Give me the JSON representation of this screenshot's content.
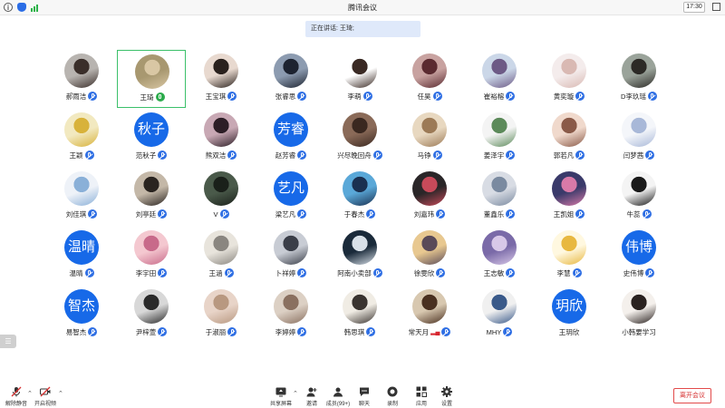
{
  "window": {
    "title": "腾讯会议",
    "clock": "17:30"
  },
  "speaker_bar": {
    "text": "正在讲话: 王琦;"
  },
  "colors": {
    "accent": "#1769e8",
    "active_border": "#3bc06a",
    "mic_icon": "#2f6fe4",
    "leave": "#d63030"
  },
  "participants": [
    {
      "name": "郝雨洁",
      "mic": "muted",
      "avatar": {
        "kind": "photo",
        "colors": [
          "#b8b4b0",
          "#3a2e2a"
        ]
      }
    },
    {
      "name": "王琦",
      "mic": "speaking",
      "active": true,
      "avatar": {
        "kind": "photo",
        "colors": [
          "#a89870",
          "#d9c7a4"
        ]
      }
    },
    {
      "name": "王宝琪",
      "mic": "muted",
      "avatar": {
        "kind": "photo",
        "colors": [
          "#e8d9cf",
          "#2a211d"
        ]
      }
    },
    {
      "name": "张睿思",
      "mic": "muted",
      "avatar": {
        "kind": "photo",
        "colors": [
          "#8c9bb0",
          "#1d2330"
        ]
      }
    },
    {
      "name": "李萌",
      "mic": "muted",
      "avatar": {
        "kind": "photo",
        "colors": [
          "#ffffff",
          "#3a2a24"
        ]
      }
    },
    {
      "name": "任昊",
      "mic": "muted",
      "avatar": {
        "kind": "photo",
        "colors": [
          "#c8a2a0",
          "#5a2a30"
        ]
      }
    },
    {
      "name": "崔裕榕",
      "mic": "muted",
      "avatar": {
        "kind": "photo",
        "colors": [
          "#cbd7e8",
          "#6d5a86"
        ]
      }
    },
    {
      "name": "黄奕璇",
      "mic": "muted",
      "avatar": {
        "kind": "photo",
        "colors": [
          "#f4ecec",
          "#d9b9b3"
        ]
      }
    },
    {
      "name": "D李玖瑶",
      "mic": "muted",
      "avatar": {
        "kind": "photo",
        "colors": [
          "#9aa39a",
          "#2c2a26"
        ]
      }
    },
    {
      "name": "王颖",
      "mic": "muted",
      "avatar": {
        "kind": "photo",
        "colors": [
          "#f2e9c0",
          "#d8b23a"
        ]
      }
    },
    {
      "name": "范秋子",
      "mic": "muted",
      "avatar": {
        "kind": "text",
        "text": "秋子"
      }
    },
    {
      "name": "熊双洁",
      "mic": "muted",
      "avatar": {
        "kind": "photo",
        "colors": [
          "#c8a8b4",
          "#2c1e26"
        ]
      }
    },
    {
      "name": "赵芳睿",
      "mic": "muted",
      "avatar": {
        "kind": "text",
        "text": "芳睿"
      }
    },
    {
      "name": "兴尽晚回舟",
      "mic": "muted",
      "avatar": {
        "kind": "photo",
        "colors": [
          "#8a6a58",
          "#3a2820"
        ]
      }
    },
    {
      "name": "马铮",
      "mic": "muted",
      "avatar": {
        "kind": "photo",
        "colors": [
          "#e8d8c0",
          "#9c7a56"
        ]
      }
    },
    {
      "name": "姜泽宇",
      "mic": "muted",
      "avatar": {
        "kind": "photo",
        "colors": [
          "#f4f4f4",
          "#5c8a5a"
        ]
      }
    },
    {
      "name": "郭若凡",
      "mic": "muted",
      "avatar": {
        "kind": "photo",
        "colors": [
          "#f0d9cc",
          "#8a5a48"
        ]
      }
    },
    {
      "name": "闫梦茜",
      "mic": "muted",
      "avatar": {
        "kind": "photo",
        "colors": [
          "#f4f6fa",
          "#a8b8d8"
        ]
      }
    },
    {
      "name": "刘佳琪",
      "mic": "muted",
      "avatar": {
        "kind": "photo",
        "colors": [
          "#eef2f8",
          "#8ab0d8"
        ]
      }
    },
    {
      "name": "刘亭廷",
      "mic": "muted",
      "avatar": {
        "kind": "photo",
        "colors": [
          "#c4b8a8",
          "#2a2420"
        ]
      }
    },
    {
      "name": "V",
      "mic": "muted",
      "avatar": {
        "kind": "photo",
        "colors": [
          "#4a5a4a",
          "#1a201a"
        ]
      }
    },
    {
      "name": "梁艺凡",
      "mic": "muted",
      "avatar": {
        "kind": "text",
        "text": "艺凡"
      }
    },
    {
      "name": "于春杰",
      "mic": "muted",
      "avatar": {
        "kind": "photo",
        "colors": [
          "#5aa8d8",
          "#1a3050"
        ]
      }
    },
    {
      "name": "刘嘉玮",
      "mic": "muted",
      "avatar": {
        "kind": "photo",
        "colors": [
          "#2a2628",
          "#c84a5a"
        ]
      }
    },
    {
      "name": "董鑫乐",
      "mic": "muted",
      "avatar": {
        "kind": "photo",
        "colors": [
          "#d8dce4",
          "#7a8aa0"
        ]
      }
    },
    {
      "name": "王凯姐",
      "mic": "muted",
      "avatar": {
        "kind": "photo",
        "colors": [
          "#3a3a6a",
          "#d87aa8"
        ]
      }
    },
    {
      "name": "牛蕊",
      "mic": "muted",
      "avatar": {
        "kind": "photo",
        "colors": [
          "#f4f4f4",
          "#1a1a1a"
        ]
      }
    },
    {
      "name": "温晴",
      "mic": "muted",
      "avatar": {
        "kind": "text",
        "text": "温晴"
      }
    },
    {
      "name": "李宇田",
      "mic": "muted",
      "avatar": {
        "kind": "photo",
        "colors": [
          "#f4c8d0",
          "#c86a8a"
        ]
      }
    },
    {
      "name": "王涵",
      "mic": "muted",
      "avatar": {
        "kind": "photo",
        "colors": [
          "#e8e4dc",
          "#8a8680"
        ]
      }
    },
    {
      "name": "卜祥婷",
      "mic": "muted",
      "avatar": {
        "kind": "photo",
        "colors": [
          "#c8ccd4",
          "#3a3e48"
        ]
      }
    },
    {
      "name": "阿南小卖部",
      "mic": "muted",
      "avatar": {
        "kind": "photo",
        "colors": [
          "#1a2a3a",
          "#d8e0e8"
        ]
      }
    },
    {
      "name": "徐雯欣",
      "mic": "muted",
      "avatar": {
        "kind": "photo",
        "colors": [
          "#e8c890",
          "#5a4a58"
        ]
      }
    },
    {
      "name": "王志敏",
      "mic": "muted",
      "avatar": {
        "kind": "photo",
        "colors": [
          "#7a6aa8",
          "#d8c8e8"
        ]
      }
    },
    {
      "name": "李慧",
      "mic": "muted",
      "avatar": {
        "kind": "photo",
        "colors": [
          "#fff8e0",
          "#e8b840"
        ]
      }
    },
    {
      "name": "史伟博",
      "mic": "muted",
      "avatar": {
        "kind": "text",
        "text": "伟博"
      }
    },
    {
      "name": "易智杰",
      "mic": "muted",
      "avatar": {
        "kind": "text",
        "text": "智杰"
      }
    },
    {
      "name": "尹梓萱",
      "mic": "muted",
      "avatar": {
        "kind": "photo",
        "colors": [
          "#d8d8d8",
          "#2a2a2a"
        ]
      }
    },
    {
      "name": "于淑丽",
      "mic": "muted",
      "avatar": {
        "kind": "photo",
        "colors": [
          "#e8d4c8",
          "#b89880"
        ]
      }
    },
    {
      "name": "李婷婷",
      "mic": "muted",
      "avatar": {
        "kind": "photo",
        "colors": [
          "#dcd0c4",
          "#8a7060"
        ]
      }
    },
    {
      "name": "韩思琪",
      "mic": "muted",
      "avatar": {
        "kind": "photo",
        "colors": [
          "#f0ece4",
          "#3a3430"
        ]
      }
    },
    {
      "name": "常天月",
      "mic": "muted",
      "signal": true,
      "avatar": {
        "kind": "photo",
        "colors": [
          "#d8c8b0",
          "#4a3020"
        ]
      }
    },
    {
      "name": "MHY",
      "mic": "muted",
      "avatar": {
        "kind": "photo",
        "colors": [
          "#f0f0f0",
          "#3a5a8a"
        ]
      }
    },
    {
      "name": "王玥欣",
      "mic": "none",
      "avatar": {
        "kind": "text",
        "text": "玥欣"
      }
    },
    {
      "name": "小韩要学习",
      "mic": "none",
      "avatar": {
        "kind": "photo",
        "colors": [
          "#f4f0ec",
          "#2a2220"
        ]
      }
    }
  ],
  "toolbar": {
    "unmute": "解除静音",
    "start_video": "开启视频",
    "share_screen": "共享屏幕",
    "invite": "邀请",
    "members": "成员(99+)",
    "chat": "聊天",
    "record": "录制",
    "apps": "应用",
    "settings": "设置",
    "leave": "离开会议"
  }
}
